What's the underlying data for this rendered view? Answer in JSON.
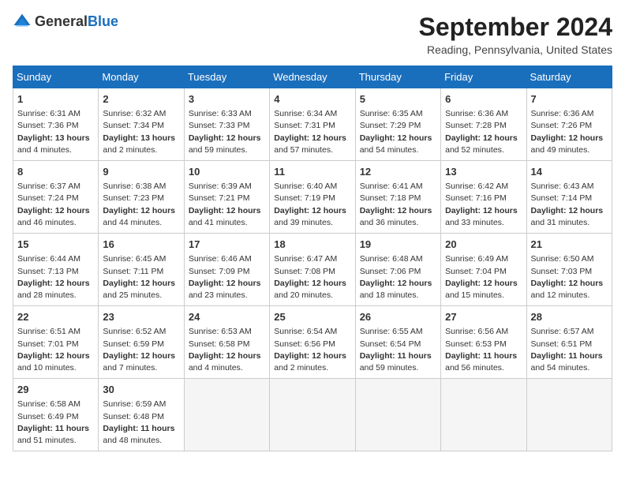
{
  "header": {
    "logo_general": "General",
    "logo_blue": "Blue",
    "title": "September 2024",
    "location": "Reading, Pennsylvania, United States"
  },
  "days_of_week": [
    "Sunday",
    "Monday",
    "Tuesday",
    "Wednesday",
    "Thursday",
    "Friday",
    "Saturday"
  ],
  "weeks": [
    [
      {
        "day": "1",
        "sunrise": "6:31 AM",
        "sunset": "7:36 PM",
        "daylight": "13 hours and 4 minutes"
      },
      {
        "day": "2",
        "sunrise": "6:32 AM",
        "sunset": "7:34 PM",
        "daylight": "13 hours and 2 minutes"
      },
      {
        "day": "3",
        "sunrise": "6:33 AM",
        "sunset": "7:33 PM",
        "daylight": "12 hours and 59 minutes"
      },
      {
        "day": "4",
        "sunrise": "6:34 AM",
        "sunset": "7:31 PM",
        "daylight": "12 hours and 57 minutes"
      },
      {
        "day": "5",
        "sunrise": "6:35 AM",
        "sunset": "7:29 PM",
        "daylight": "12 hours and 54 minutes"
      },
      {
        "day": "6",
        "sunrise": "6:36 AM",
        "sunset": "7:28 PM",
        "daylight": "12 hours and 52 minutes"
      },
      {
        "day": "7",
        "sunrise": "6:36 AM",
        "sunset": "7:26 PM",
        "daylight": "12 hours and 49 minutes"
      }
    ],
    [
      {
        "day": "8",
        "sunrise": "6:37 AM",
        "sunset": "7:24 PM",
        "daylight": "12 hours and 46 minutes"
      },
      {
        "day": "9",
        "sunrise": "6:38 AM",
        "sunset": "7:23 PM",
        "daylight": "12 hours and 44 minutes"
      },
      {
        "day": "10",
        "sunrise": "6:39 AM",
        "sunset": "7:21 PM",
        "daylight": "12 hours and 41 minutes"
      },
      {
        "day": "11",
        "sunrise": "6:40 AM",
        "sunset": "7:19 PM",
        "daylight": "12 hours and 39 minutes"
      },
      {
        "day": "12",
        "sunrise": "6:41 AM",
        "sunset": "7:18 PM",
        "daylight": "12 hours and 36 minutes"
      },
      {
        "day": "13",
        "sunrise": "6:42 AM",
        "sunset": "7:16 PM",
        "daylight": "12 hours and 33 minutes"
      },
      {
        "day": "14",
        "sunrise": "6:43 AM",
        "sunset": "7:14 PM",
        "daylight": "12 hours and 31 minutes"
      }
    ],
    [
      {
        "day": "15",
        "sunrise": "6:44 AM",
        "sunset": "7:13 PM",
        "daylight": "12 hours and 28 minutes"
      },
      {
        "day": "16",
        "sunrise": "6:45 AM",
        "sunset": "7:11 PM",
        "daylight": "12 hours and 25 minutes"
      },
      {
        "day": "17",
        "sunrise": "6:46 AM",
        "sunset": "7:09 PM",
        "daylight": "12 hours and 23 minutes"
      },
      {
        "day": "18",
        "sunrise": "6:47 AM",
        "sunset": "7:08 PM",
        "daylight": "12 hours and 20 minutes"
      },
      {
        "day": "19",
        "sunrise": "6:48 AM",
        "sunset": "7:06 PM",
        "daylight": "12 hours and 18 minutes"
      },
      {
        "day": "20",
        "sunrise": "6:49 AM",
        "sunset": "7:04 PM",
        "daylight": "12 hours and 15 minutes"
      },
      {
        "day": "21",
        "sunrise": "6:50 AM",
        "sunset": "7:03 PM",
        "daylight": "12 hours and 12 minutes"
      }
    ],
    [
      {
        "day": "22",
        "sunrise": "6:51 AM",
        "sunset": "7:01 PM",
        "daylight": "12 hours and 10 minutes"
      },
      {
        "day": "23",
        "sunrise": "6:52 AM",
        "sunset": "6:59 PM",
        "daylight": "12 hours and 7 minutes"
      },
      {
        "day": "24",
        "sunrise": "6:53 AM",
        "sunset": "6:58 PM",
        "daylight": "12 hours and 4 minutes"
      },
      {
        "day": "25",
        "sunrise": "6:54 AM",
        "sunset": "6:56 PM",
        "daylight": "12 hours and 2 minutes"
      },
      {
        "day": "26",
        "sunrise": "6:55 AM",
        "sunset": "6:54 PM",
        "daylight": "11 hours and 59 minutes"
      },
      {
        "day": "27",
        "sunrise": "6:56 AM",
        "sunset": "6:53 PM",
        "daylight": "11 hours and 56 minutes"
      },
      {
        "day": "28",
        "sunrise": "6:57 AM",
        "sunset": "6:51 PM",
        "daylight": "11 hours and 54 minutes"
      }
    ],
    [
      {
        "day": "29",
        "sunrise": "6:58 AM",
        "sunset": "6:49 PM",
        "daylight": "11 hours and 51 minutes"
      },
      {
        "day": "30",
        "sunrise": "6:59 AM",
        "sunset": "6:48 PM",
        "daylight": "11 hours and 48 minutes"
      },
      null,
      null,
      null,
      null,
      null
    ]
  ],
  "labels": {
    "sunrise": "Sunrise:",
    "sunset": "Sunset:",
    "daylight": "Daylight:"
  }
}
